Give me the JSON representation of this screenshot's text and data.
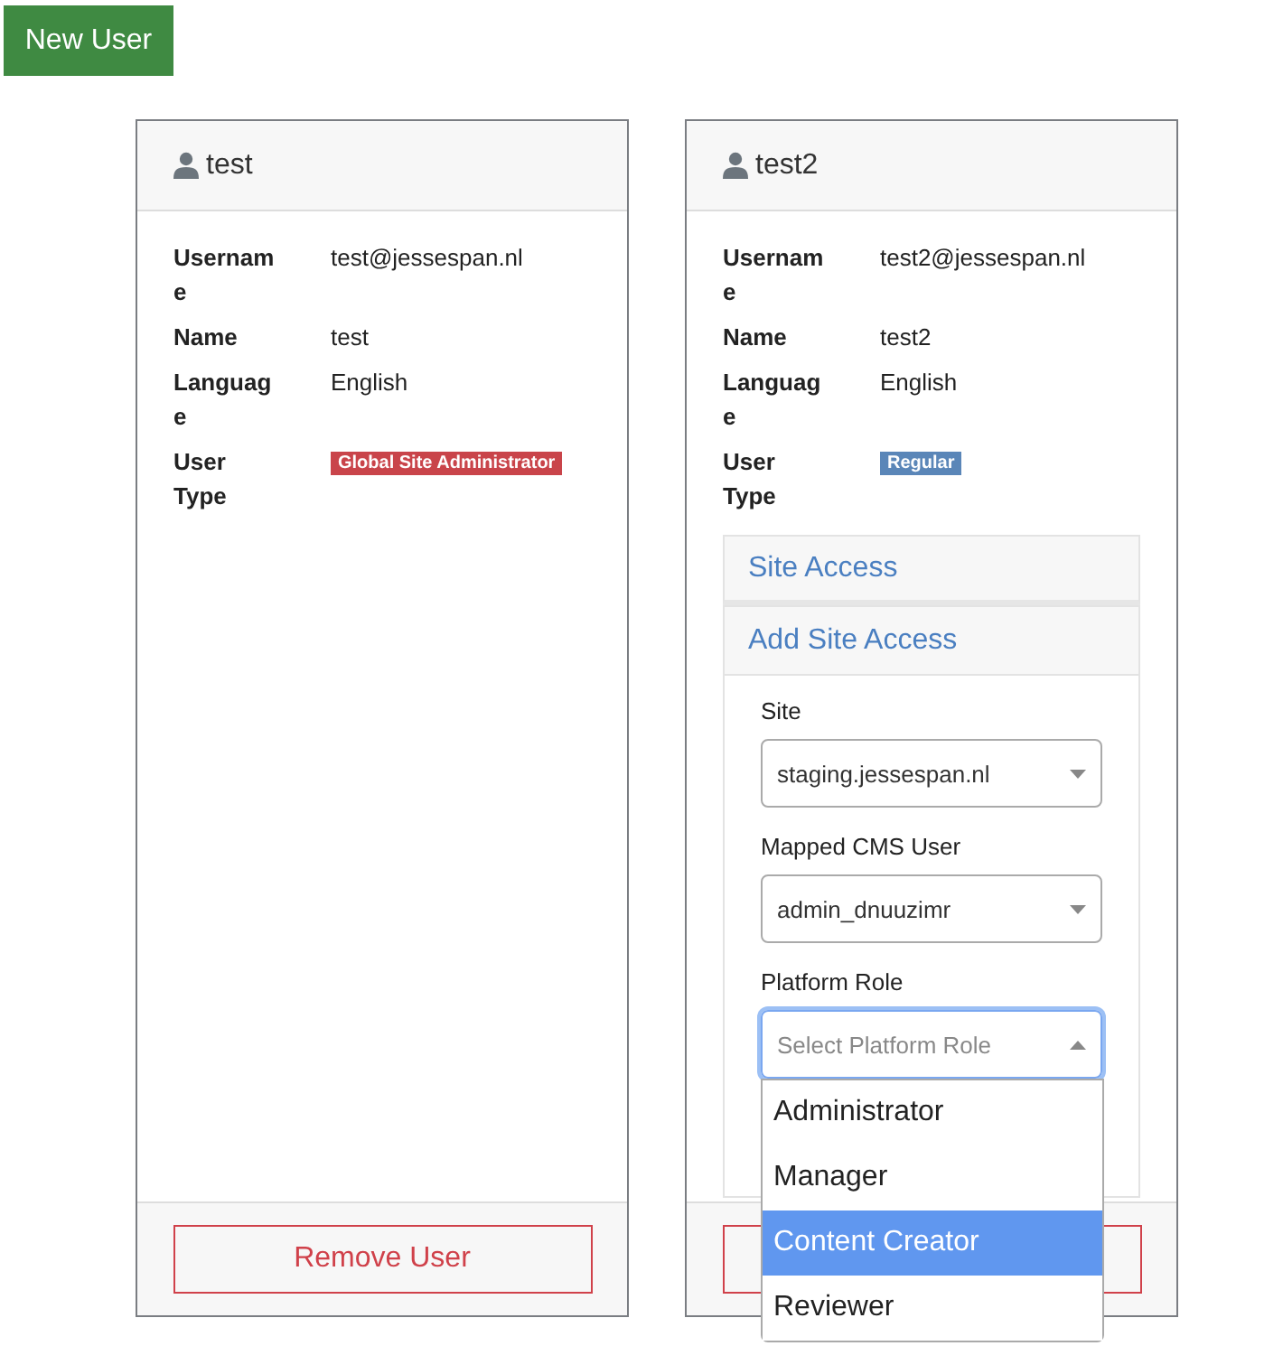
{
  "new_user_button": "New User",
  "users": [
    {
      "name": "test",
      "details": [
        {
          "label": "Usernam e",
          "value": "test@jessespan.nl",
          "kind": "text"
        },
        {
          "label": "Name",
          "value": "test",
          "kind": "text"
        },
        {
          "label": "Languag e",
          "value": "English",
          "kind": "text"
        },
        {
          "label": "User Type",
          "value": "Global Site Administrator",
          "kind": "badge",
          "color": "#c9444a"
        }
      ],
      "remove_button": "Remove User"
    },
    {
      "name": "test2",
      "details": [
        {
          "label": "Usernam e",
          "value": "test2@jessespan.nl",
          "kind": "text"
        },
        {
          "label": "Name",
          "value": "test2",
          "kind": "text"
        },
        {
          "label": "Languag e",
          "value": "English",
          "kind": "text"
        },
        {
          "label": "User Type",
          "value": "Regular",
          "kind": "badge",
          "color": "#5a86b8"
        }
      ],
      "site_access": {
        "sections": [
          {
            "title": "Site Access",
            "expanded": false
          },
          {
            "title": "Add Site Access",
            "expanded": true
          }
        ],
        "fields": [
          {
            "label": "Site",
            "value": "staging.jessespan.nl"
          },
          {
            "label": "Mapped CMS User",
            "value": "admin_dnuuzimr"
          },
          {
            "label": "Platform Role",
            "placeholder": "Select Platform Role",
            "open": true,
            "options": [
              {
                "label": "Administrator",
                "selected": false
              },
              {
                "label": "Manager",
                "selected": false
              },
              {
                "label": "Content Creator",
                "selected": true
              },
              {
                "label": "Reviewer",
                "selected": false
              }
            ]
          }
        ]
      }
    }
  ]
}
